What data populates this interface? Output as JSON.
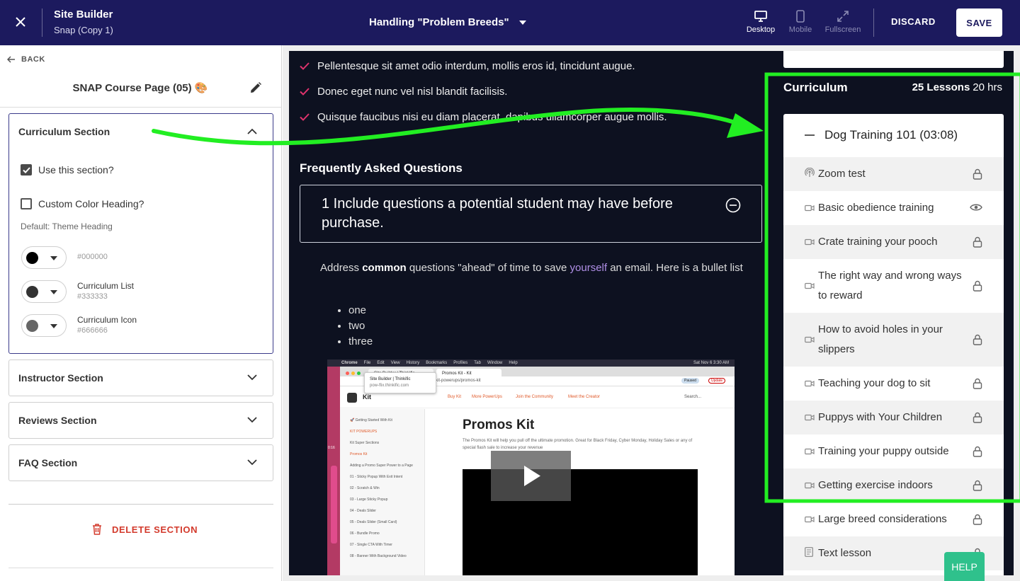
{
  "header": {
    "title": "Site Builder",
    "subtitle": "Snap (Copy 1)",
    "page_selector": "Handling \"Problem Breeds\"",
    "devices": [
      {
        "label": "Desktop",
        "active": true
      },
      {
        "label": "Mobile",
        "active": false
      },
      {
        "label": "Fullscreen",
        "active": false
      }
    ],
    "discard_label": "DISCARD",
    "save_label": "SAVE"
  },
  "sidebar": {
    "back_label": "BACK",
    "page_name": "SNAP Course Page (05) 🎨",
    "open_section": {
      "title": "Curriculum Section",
      "use_section_label": "Use this section?",
      "use_section_checked": true,
      "custom_color_label": "Custom Color Heading?",
      "custom_color_checked": false,
      "default_note": "Default: Theme Heading",
      "colors": [
        {
          "name": "",
          "hex": "#000000",
          "swatch": "#000000"
        },
        {
          "name": "Curriculum List",
          "hex": "#333333",
          "swatch": "#333333"
        },
        {
          "name": "Curriculum Icon",
          "hex": "#666666",
          "swatch": "#666666"
        }
      ]
    },
    "sections": [
      "Instructor Section",
      "Reviews Section",
      "FAQ Section"
    ],
    "delete_label": "DELETE SECTION"
  },
  "preview": {
    "bullets": [
      "Pellentesque sit amet odio interdum, mollis eros id, tincidunt augue.",
      "Donec eget nunc vel nisl blandit facilisis.",
      "Quisque faucibus nisi eu diam placerat, dapibus ullamcorper augue mollis."
    ],
    "faq_heading": "Frequently Asked Questions",
    "faq_question": "1 Include questions a potential student may have before purchase.",
    "faq_answer": {
      "p1": "Address ",
      "bold": "common",
      "p2": " questions \"ahead\" of time to save ",
      "link": "yourself",
      "p3": " an email. Here is a bullet list"
    },
    "faq_list": [
      "one",
      "two",
      "three"
    ],
    "video": {
      "menubar": [
        "Chrome",
        "File",
        "Edit",
        "View",
        "History",
        "Bookmarks",
        "Profiles",
        "Tab",
        "Window",
        "Help"
      ],
      "clock": "Sat Nov 6 3:30 AM",
      "tabs": [
        "Site Builder | Thinkific",
        "Promos Kit - Kit"
      ],
      "tooltip_title": "Site Builder | Thinkific",
      "tooltip_url": "pow-flix.thinkific.com",
      "url": "kit-powerups/promos-kit",
      "paused_label": "Paused",
      "update_label": "Update",
      "logo": "Kit",
      "nav": [
        "Buy Kit",
        "More PowerUps",
        "Join the Community",
        "Meet the Creator"
      ],
      "search_placeholder": "Search...",
      "side_items": [
        "🚀 Getting Started With Kit",
        "KIT POWERUPS",
        "Kit Super Sections",
        "Promos Kit",
        "Adding a Promo Super Power to a Page",
        "01 - Sticky Popup With Exit Intent",
        "02 - Scratch & Win",
        "03 - Large Sticky Popup",
        "04 - Deals Slider",
        "05 - Deals Slider (Small Card)",
        "06 - Bundle Promo",
        "07 - Single CTA With Timer",
        "08 - Banner With Background Video"
      ],
      "heading": "Promos Kit",
      "body": "The Promos Kit will help you pull off the ultimate promotion. Great for Black Friday, Cyber Monday, Holiday Sales or any of special flash sale to increase your revenue",
      "dock_time": "0:16"
    },
    "curriculum": {
      "title": "Curriculum",
      "lessons_count": "25 Lessons",
      "duration": "20 hrs",
      "chapter": "Dog Training 101 (03:08)",
      "lessons": [
        {
          "title": "Zoom test",
          "icon": "broadcast-icon",
          "status": "lock-icon"
        },
        {
          "title": "Basic obedience training",
          "icon": "video-icon",
          "status": "eye-icon"
        },
        {
          "title": "Crate training your pooch",
          "icon": "video-icon",
          "status": "lock-icon"
        },
        {
          "title": "The right way and wrong ways to reward",
          "icon": "video-icon",
          "status": "lock-icon"
        },
        {
          "title": "How to avoid holes in your slippers",
          "icon": "video-icon",
          "status": "lock-icon"
        },
        {
          "title": "Teaching your dog to sit",
          "icon": "video-icon",
          "status": "lock-icon"
        },
        {
          "title": "Puppys with Your Children",
          "icon": "video-icon",
          "status": "lock-icon"
        },
        {
          "title": "Training your puppy outside",
          "icon": "video-icon",
          "status": "lock-icon"
        },
        {
          "title": "Getting exercise indoors",
          "icon": "video-icon",
          "status": "lock-icon"
        },
        {
          "title": "Large breed considerations",
          "icon": "video-icon",
          "status": "lock-icon"
        },
        {
          "title": "Text lesson",
          "icon": "text-icon",
          "status": "lock-icon"
        }
      ]
    }
  },
  "help_label": "HELP",
  "colors": {
    "topbar": "#1c1a5e",
    "check_pink": "#e0336d",
    "highlight_green": "#22ee22",
    "delete_red": "#d33a2c",
    "help_green": "#2fc18c"
  }
}
